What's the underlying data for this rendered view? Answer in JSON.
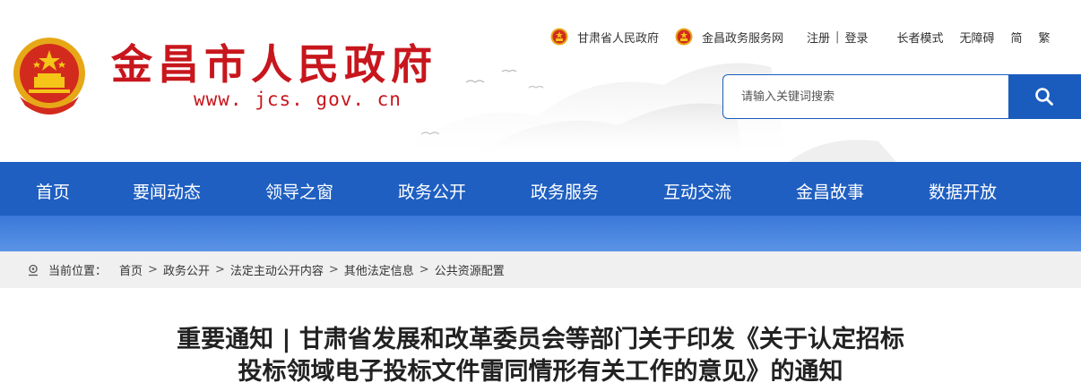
{
  "site": {
    "title": "金昌市人民政府",
    "url": "www. jcs. gov. cn"
  },
  "toplinks": {
    "province_gov": "甘肃省人民政府",
    "gov_service": "金昌政务服务网",
    "register": "注册",
    "separator": "|",
    "login": "登录",
    "elder_mode": "长者模式",
    "accessible": "无障碍",
    "simplified": "简",
    "traditional": "繁"
  },
  "search": {
    "placeholder": "请输入关键词搜索",
    "icon": "search-icon"
  },
  "nav": {
    "items": [
      {
        "label": "首页"
      },
      {
        "label": "要闻动态"
      },
      {
        "label": "领导之窗"
      },
      {
        "label": "政务公开"
      },
      {
        "label": "政务服务"
      },
      {
        "label": "互动交流"
      },
      {
        "label": "金昌故事"
      },
      {
        "label": "数据开放"
      }
    ]
  },
  "breadcrumb": {
    "label": "当前位置：",
    "separator": ">",
    "items": [
      "首页",
      "政务公开",
      "法定主动公开内容",
      "其他法定信息",
      "公共资源配置"
    ]
  },
  "article": {
    "title_line1": "重要通知 | 甘肃省发展和改革委员会等部门关于印发《关于认定招标",
    "title_line2": "投标领域电子投标文件雷同情形有关工作的意见》的通知"
  },
  "colors": {
    "brand_red": "#c8161d",
    "nav_blue": "#1f5fc1",
    "accent_blue": "#1a5cbd"
  }
}
